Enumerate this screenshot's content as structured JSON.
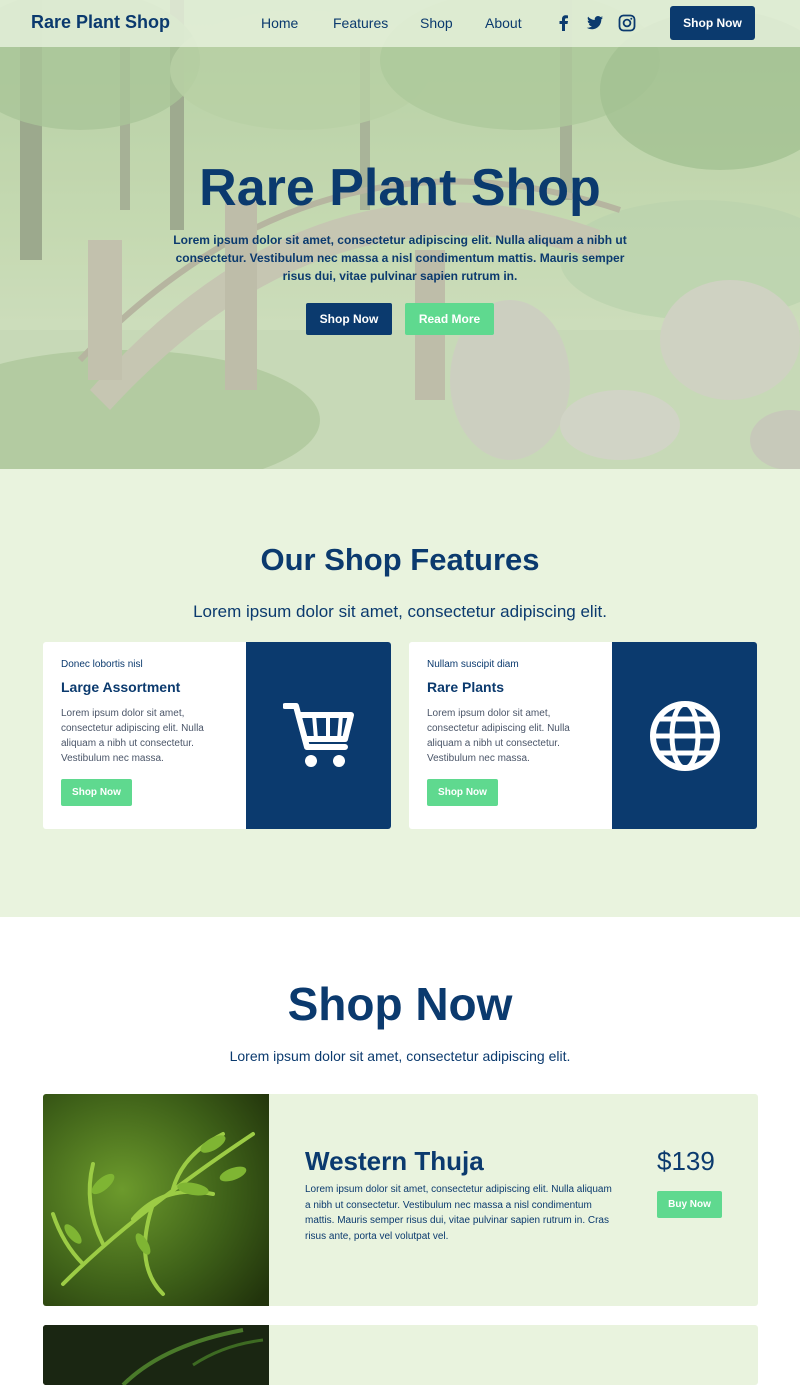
{
  "nav": {
    "brand": "Rare Plant Shop",
    "links": [
      "Home",
      "Features",
      "Shop",
      "About"
    ],
    "social_icons": [
      "facebook-icon",
      "twitter-icon",
      "instagram-icon"
    ],
    "cta": "Shop Now"
  },
  "hero": {
    "title": "Rare Plant Shop",
    "text": "Lorem ipsum dolor sit amet, consectetur adipiscing elit. Nulla aliquam a nibh ut consectetur. Vestibulum nec massa a nisl condimentum mattis. Mauris semper risus dui, vitae pulvinar sapien rutrum in.",
    "primary_button": "Shop Now",
    "secondary_button": "Read More"
  },
  "features": {
    "title": "Our Shop Features",
    "subtitle": "Lorem ipsum dolor sit amet, consectetur adipiscing elit.",
    "cards": [
      {
        "kicker": "Donec lobortis nisl",
        "title": "Large Assortment",
        "body": "Lorem ipsum dolor sit amet, consectetur adipiscing elit. Nulla aliquam a nibh ut consectetur. Vestibulum nec massa.",
        "button": "Shop Now",
        "icon": "cart-icon"
      },
      {
        "kicker": "Nullam suscipit diam",
        "title": "Rare Plants",
        "body": "Lorem ipsum dolor sit amet, consectetur adipiscing elit. Nulla aliquam a nibh ut consectetur. Vestibulum nec massa.",
        "button": "Shop Now",
        "icon": "globe-icon"
      }
    ]
  },
  "shop": {
    "title": "Shop Now",
    "subtitle": "Lorem ipsum dolor sit amet, consectetur adipiscing elit.",
    "products": [
      {
        "name": "Western Thuja",
        "description": "Lorem ipsum dolor sit amet, consectetur adipiscing elit. Nulla aliquam a nibh ut consectetur. Vestibulum nec massa a nisl condimentum mattis. Mauris semper risus dui, vitae pulvinar sapien rutrum in. Cras risus ante, porta vel volutpat vel.",
        "price": "$139",
        "button": "Buy Now"
      }
    ]
  },
  "colors": {
    "navy": "#0b3a6e",
    "green": "#5fd98f",
    "mint_bg": "#e9f3de"
  }
}
